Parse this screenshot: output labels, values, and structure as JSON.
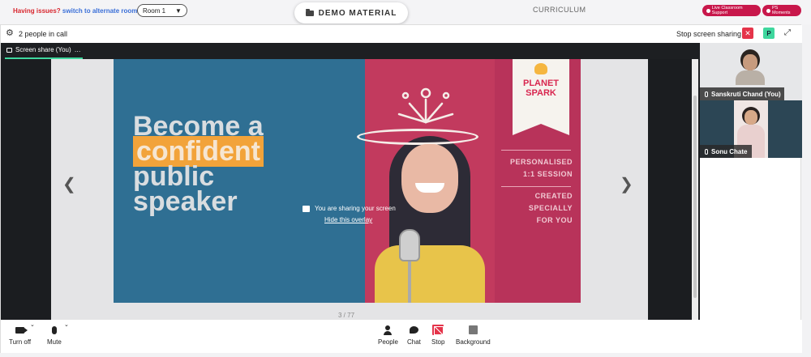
{
  "topbar": {
    "issue_prefix": "Having issues?",
    "issue_link": "switch to alternate room",
    "room_label": "Room 1",
    "demo_label": "DEMO MATERIAL",
    "curriculum_label": "CURRICULUM",
    "live_support_label": "Live Classroom Support",
    "ps_moments_label": "PS Moments"
  },
  "call": {
    "people_count": "2 people in call",
    "stop_sharing_label": "Stop screen sharing",
    "participant_initial": "P",
    "share_tab_label": "Screen share (You)",
    "share_tab_more": "…",
    "overlay_text": "You are sharing your screen",
    "overlay_hide": "Hide this overlay",
    "page_indicator": "3 / 77"
  },
  "slide": {
    "headline_1": "Become a",
    "headline_2": "confident",
    "headline_3": "public",
    "headline_4": "speaker",
    "logo_1": "PLANET",
    "logo_2": "SPARK",
    "copy_1": "PERSONALISED",
    "copy_2": "1:1 SESSION",
    "copy_3": "CREATED SPECIALLY",
    "copy_4": "FOR YOU"
  },
  "participants": [
    {
      "name": "Sanskruti Chand (You)"
    },
    {
      "name": "Sonu Chate"
    }
  ],
  "toolbar": {
    "turn_off": "Turn off",
    "mute": "Mute",
    "people": "People",
    "chat": "Chat",
    "stop": "Stop",
    "background": "Background"
  },
  "colors": {
    "accent_red": "#e5344a",
    "accent_green": "#3fd79e",
    "pill_pink": "#c8174b"
  }
}
